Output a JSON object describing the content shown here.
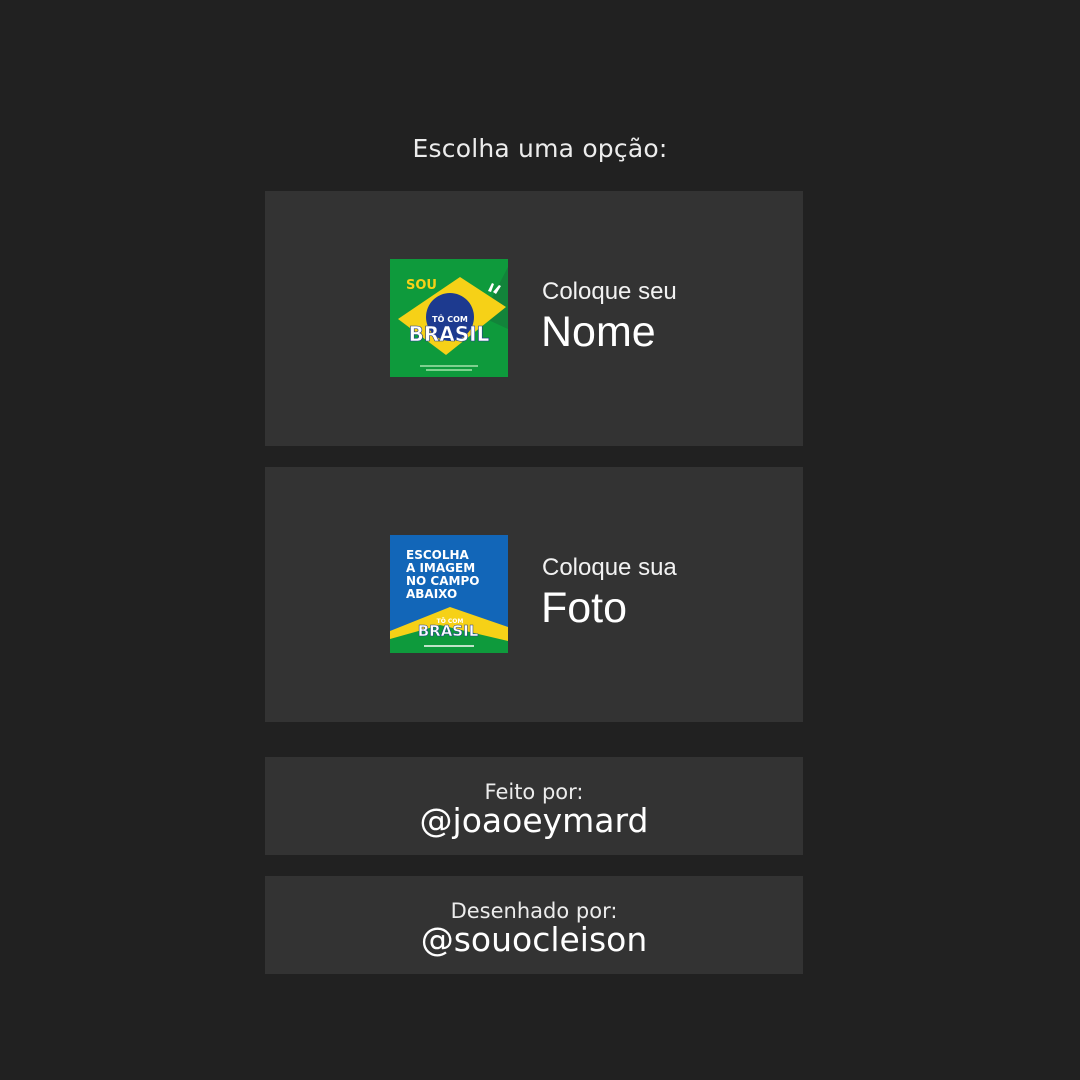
{
  "prompt": "Escolha uma opção:",
  "options": [
    {
      "small": "Coloque seu",
      "big": "Nome",
      "thumb": {
        "top_text": "SOU",
        "badge_text": "TÔ COM",
        "main_text": "BRASIL",
        "icon": "brazil-flag-thumbnail"
      }
    },
    {
      "small": "Coloque sua",
      "big": "Foto",
      "thumb": {
        "lines": [
          "ESCOLHA",
          "A IMAGEM",
          "NO CAMPO",
          "ABAIXO"
        ],
        "badge_text": "TÔ COM",
        "main_text": "BRASIL",
        "icon": "choose-image-thumbnail"
      }
    }
  ],
  "credits": [
    {
      "label": "Feito por:",
      "handle": "@joaoeymard"
    },
    {
      "label": "Desenhado por:",
      "handle": "@souocleison"
    }
  ],
  "colors": {
    "background": "#212121",
    "card": "#333333",
    "flag_green": "#0e9a3c",
    "flag_yellow": "#f6d117",
    "flag_blue": "#1d3a8f",
    "photo_blue": "#1266b8"
  }
}
